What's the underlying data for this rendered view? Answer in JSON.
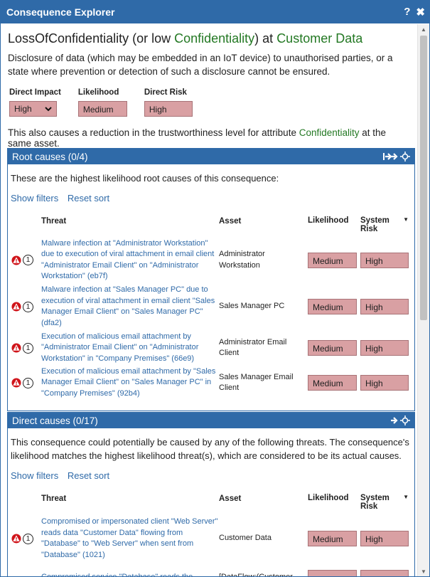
{
  "window": {
    "title": "Consequence Explorer",
    "help_icon": "question-icon",
    "close_icon": "close-icon"
  },
  "header": {
    "title_prefix": "LossOfConfidentiality (or low ",
    "title_attr": "Confidentiality",
    "title_mid": ") at ",
    "title_asset": "Customer Data",
    "description": "Disclosure of data (which may be embedded in an IoT device) to unauthorised parties, or a state where prevention or detection of such a disclosure cannot be ensured."
  },
  "metrics": {
    "direct_impact": {
      "label": "Direct Impact",
      "value": "High"
    },
    "likelihood": {
      "label": "Likelihood",
      "value": "Medium"
    },
    "direct_risk": {
      "label": "Direct Risk",
      "value": "High"
    }
  },
  "also_text": {
    "prefix": "This also causes a reduction in the trustworthiness level for attribute ",
    "attr": "Confidentiality",
    "suffix": " at the same asset."
  },
  "root_causes": {
    "title": "Root causes (0/4)",
    "intro": "These are the highest likelihood root causes of this consequence:",
    "show_filters": "Show filters",
    "reset_sort": "Reset sort",
    "columns": {
      "threat": "Threat",
      "asset": "Asset",
      "likelihood": "Likelihood",
      "system_risk": "System Risk"
    },
    "rows": [
      {
        "threat": "Malware infection at \"Administrator Workstation\" due to execution of viral attachment in email client \"Administrator Email Client\" on \"Administrator Workstation\" (eb7f)",
        "asset": "Administrator Workstation",
        "likelihood": "Medium",
        "risk": "High",
        "badge": "1"
      },
      {
        "threat": "Malware infection at \"Sales Manager PC\" due to execution of viral attachment in email client \"Sales Manager Email Client\" on \"Sales Manager PC\" (dfa2)",
        "asset": "Sales Manager PC",
        "likelihood": "Medium",
        "risk": "High",
        "badge": "1"
      },
      {
        "threat": "Execution of malicious email attachment by \"Administrator Email Client\" on \"Administrator Workstation\" in \"Company Premises\" (66e9)",
        "asset": "Administrator Email Client",
        "likelihood": "Medium",
        "risk": "High",
        "badge": "1"
      },
      {
        "threat": "Execution of malicious email attachment by \"Sales Manager Email Client\" on \"Sales Manager PC\" in \"Company Premises\" (92b4)",
        "asset": "Sales Manager Email Client",
        "likelihood": "Medium",
        "risk": "High",
        "badge": "1"
      }
    ]
  },
  "direct_causes": {
    "title": "Direct causes (0/17)",
    "intro": "This consequence could potentially be caused by any of the following threats. The consequence's likelihood matches the highest likelihood threat(s), which are considered to be its actual causes.",
    "show_filters": "Show filters",
    "reset_sort": "Reset sort",
    "columns": {
      "threat": "Threat",
      "asset": "Asset",
      "likelihood": "Likelihood",
      "system_risk": "System Risk"
    },
    "rows": [
      {
        "threat": "Compromised or impersonated client \"Web Server\" reads data \"Customer Data\" flowing from \"Database\" to \"Web Server\" when sent from \"Database\" (1021)",
        "asset": "Customer Data",
        "likelihood": "Medium",
        "risk": "High",
        "badge": "1"
      },
      {
        "threat": "Compromised service \"Database\" reads the",
        "asset": "[DataFlow:(Customer",
        "likelihood": "",
        "risk": "",
        "badge": ""
      }
    ]
  },
  "colors": {
    "brand": "#2f6aa8",
    "level_fill": "#d9a0a3",
    "link": "#2f6aa8",
    "green": "#237823",
    "warn": "#d0141a"
  }
}
